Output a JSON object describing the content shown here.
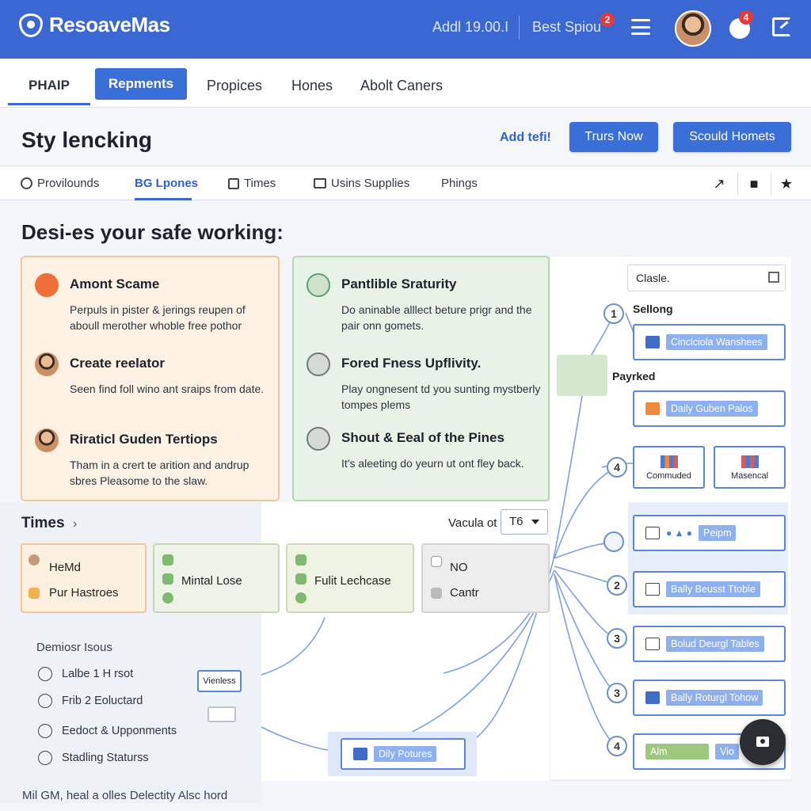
{
  "app": {
    "name": "ResoaveMas",
    "stat": "Addl 19.00.I",
    "best_label": "Best Spiou",
    "best_badge": "2",
    "notif_badge": "4"
  },
  "nav": {
    "items": [
      "PHAIP",
      "Repments",
      "Propices",
      "Hones",
      "Abolt Caners"
    ]
  },
  "page": {
    "title": "Sty lencking",
    "link_label": "Add tefi!",
    "primary_label": "Trurs Now",
    "secondary_label": "Scould Homets"
  },
  "toolbar": {
    "tabs": [
      "Provilounds",
      "BG Lpones",
      "Times",
      "Usins Supplies",
      "Phings"
    ]
  },
  "section": {
    "title": "Desi-es your safe working:"
  },
  "features": [
    {
      "title": "Amont Scame",
      "desc": "Perpuls in pister & jerings reupen of aboull merother whoble free pothor"
    },
    {
      "title": "Create reelator",
      "desc": "Seen find foll wino ant sraips from date."
    },
    {
      "title": "Riraticl Guden Tertiops",
      "desc": "Tham in a crert te arition and andrup sbres Pleasome to the slaw."
    },
    {
      "title": "Pantlible Sraturity",
      "desc": "Do aninable alllect beture prigr and the pair onn gomets."
    },
    {
      "title": "Fored Fness Upflivity.",
      "desc": "Play ongnesent td you sunting mystberly tompes plems"
    },
    {
      "title": "Shout & Eeal of the Pines",
      "desc": "It's aleeting do yeurn ut ont fley back."
    }
  ],
  "times": {
    "title": "Times",
    "vacula_label": "Vacula ot",
    "vacula_value": "T6",
    "cards": [
      {
        "a": "HeMd",
        "b": "Pur Hastroes"
      },
      {
        "a": "Mintal Lose"
      },
      {
        "a": "Fulit Lechcase"
      },
      {
        "a": "NO",
        "b": "Cantr"
      }
    ]
  },
  "demios": {
    "title": "Demiosr Isous",
    "items": [
      "Lalbe 1 H rsot",
      "Frib 2 Eoluctard",
      "Eedoct & Upponments",
      "Stadling Staturss"
    ]
  },
  "footer": {
    "text": "Mil GM, heal a olles Delectity Alsc hord"
  },
  "diagram": {
    "search_value": "Clasle.",
    "selling_label": "Sellong",
    "payked_label": "Payrked",
    "nodes": [
      "Cinclciola Wanshees",
      "Daily Guben Palos",
      "Commuded",
      "Masencal",
      "Peipm",
      "Bally Beusst Ttoble",
      "Bolud Deurgl Tables",
      "Bally Roturgl Tohow",
      "Alm",
      "Vio",
      "Dily Potures",
      "Vienless"
    ],
    "numbers": [
      "1",
      "4",
      "2",
      "3",
      "3",
      "4"
    ]
  },
  "colors": {
    "accent": "#3a67d1",
    "orange_card": "#fdf1e4",
    "green_card": "#e8f3e7"
  }
}
